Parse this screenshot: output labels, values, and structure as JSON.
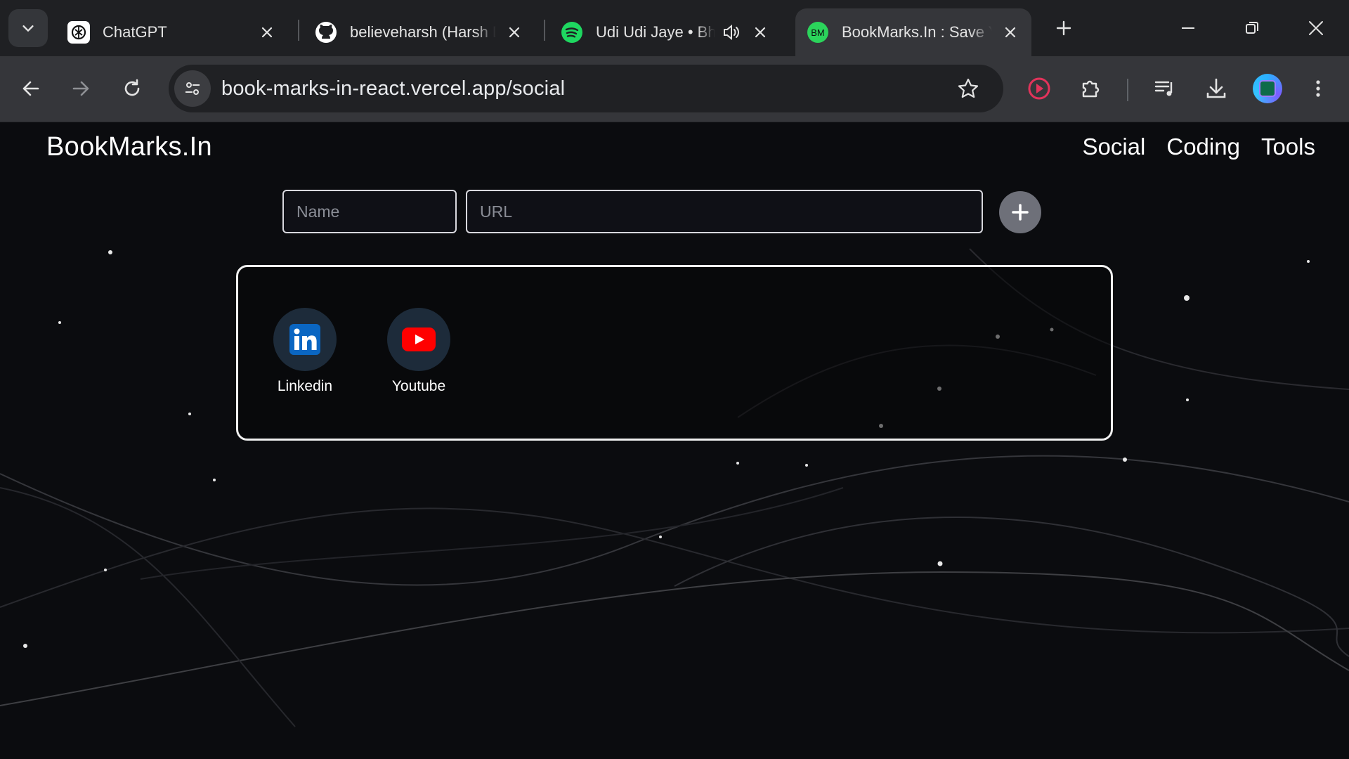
{
  "browser": {
    "tabs": [
      {
        "title": "ChatGPT",
        "icon": "chatgpt-icon",
        "active": false
      },
      {
        "title": "believeharsh (Harsh Dixit)",
        "icon": "github-icon",
        "active": false
      },
      {
        "title": "Udi Udi Jaye • Bhoomi",
        "icon": "spotify-icon",
        "active": false,
        "audio": true
      },
      {
        "title": "BookMarks.In : Save Your Bookmarks",
        "icon": "bm-favicon",
        "favicon_text": "BM",
        "active": true
      }
    ],
    "url": "book-marks-in-react.vercel.app/social"
  },
  "app": {
    "brand": "BookMarks.In",
    "nav": {
      "social": "Social",
      "coding": "Coding",
      "tools": "Tools"
    },
    "form": {
      "name_placeholder": "Name",
      "url_placeholder": "URL",
      "add_label": "+"
    },
    "bookmarks": [
      {
        "name": "Linkedin",
        "icon": "linkedin-icon"
      },
      {
        "name": "Youtube",
        "icon": "youtube-icon"
      }
    ]
  },
  "colors": {
    "tabbar_bg": "#1f2023",
    "toolbar_bg": "#35363a",
    "page_bg": "#0b0c0f",
    "spotify_green": "#1ed760",
    "bm_favicon_bg": "#2bd45b",
    "linkedin_blue": "#0a66c2",
    "youtube_red": "#ff0000",
    "add_button": "#6e7079"
  }
}
